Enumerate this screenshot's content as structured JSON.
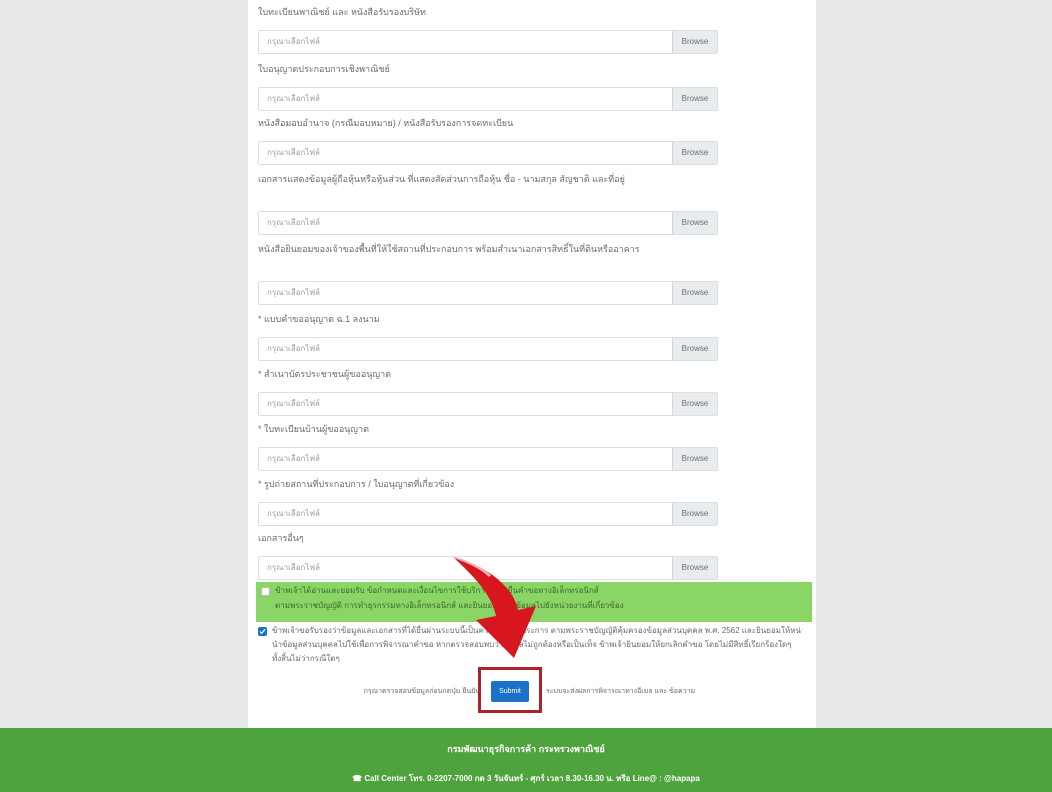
{
  "form": {
    "placeholder": "กรุณาเลือกไฟล์",
    "browse_label": "Browse",
    "fields": [
      {
        "label": "ใบทะเบียนพาณิชย์ และ หนังสือรับรองบริษัท"
      },
      {
        "label": "ใบอนุญาตประกอบการเชิงพาณิชย์"
      },
      {
        "label": "หนังสือมอบอำนาจ (กรณีมอบหมาย) / หนังสือรับรองการจดทะเบียน"
      },
      {
        "label": "เอกสารแสดงข้อมูลผู้ถือหุ้นหรือหุ้นส่วน ที่แสดงสัดส่วนการถือหุ้น ชื่อ - นามสกุล สัญชาติ และที่อยู่"
      },
      {
        "label": "หนังสือยินยอมของเจ้าของพื้นที่ให้ใช้สถานที่ประกอบการ พร้อมสำเนาเอกสารสิทธิ์ในที่ดินหรืออาคาร"
      },
      {
        "label": "* แบบคำขออนุญาต ฉ.1 ลงนาม"
      },
      {
        "label": "* สำเนาบัตรประชาชนผู้ขออนุญาต"
      },
      {
        "label": "* ใบทะเบียนบ้านผู้ขออนุญาต"
      },
      {
        "label": "* รูปถ่ายสถานที่ประกอบการ / ใบอนุญาตที่เกี่ยวข้อง"
      },
      {
        "label": "เอกสารอื่นๆ"
      }
    ]
  },
  "consent": {
    "green_line1": "ข้าพเจ้าได้อ่านและยอมรับ ข้อกำหนดและเงื่อนไขการใช้บริการระบบยื่นคำขอทางอิเล็กทรอนิกส์",
    "green_line2": "ตามพระราชบัญญัติ การทำธุรกรรมทางอิเล็กทรอนิกส์ และยินยอมให้ส่งข้อมูลไปยังหน่วยงานที่เกี่ยวข้อง",
    "line1": "ข้าพเจ้าขอรับรองว่าข้อมูลและเอกสารที่ได้ยื่นผ่านระบบนี้เป็นความจริงทุกประการ ตามพระราชบัญญัติคุ้มครองข้อมูลส่วนบุคคล พ.ศ. 2562 และยินยอมให้หน่วยงาน",
    "line2": "นำข้อมูลส่วนบุคคลไปใช้เพื่อการพิจารณาคำขอ หากตรวจสอบพบว่าข้อมูลไม่ถูกต้องหรือเป็นเท็จ ข้าพเจ้ายินยอมให้ยกเลิกคำขอ โดยไม่มีสิทธิ์เรียกร้องใดๆ",
    "line3": "ทั้งสิ้นไม่ว่ากรณีใดๆ"
  },
  "submit": {
    "before_text": "กรุณาตรวจสอบข้อมูลก่อนกดปุ่ม ยืนยัน",
    "label": "Submit",
    "after_text": "ระบบจะส่งผลการพิจารณาทางอีเมล และ ข้อความ"
  },
  "footer": {
    "title": "กรมพัฒนาธุรกิจการค้า กระทรวงพาณิชย์",
    "contact": "Call Center โทร. 0-2207-7000 กด 3 วันจันทร์ - ศุกร์ เวลา 8.30-16.30 น. หรือ Line@ : @hapapa"
  },
  "colors": {
    "accent_green": "#89d565",
    "footer_green": "#4fa33c",
    "submit_blue": "#1a73c9",
    "highlight_red": "#b0222a",
    "arrow_red": "#d8161d"
  }
}
